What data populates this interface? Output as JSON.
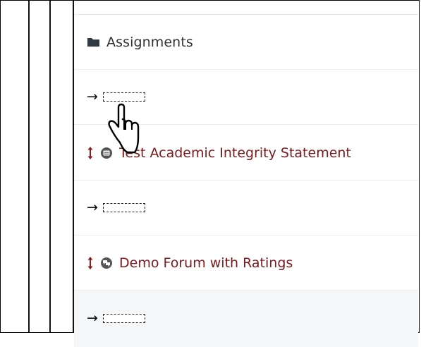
{
  "section": {
    "title": "Assignments",
    "icon": "folder-icon"
  },
  "rows": [
    {
      "type": "dropzone",
      "arrow": "→"
    },
    {
      "type": "activity",
      "label": "Test Academic Integrity Statement",
      "icon": "quiz-icon",
      "move_icon": "move-icon"
    },
    {
      "type": "dropzone",
      "arrow": "→"
    },
    {
      "type": "activity",
      "label": "Demo Forum with Ratings",
      "icon": "forum-icon",
      "move_icon": "move-icon"
    },
    {
      "type": "dropzone",
      "arrow": "→"
    }
  ],
  "colors": {
    "link": "#7a1a1a",
    "move": "#8b1a1a",
    "text": "#333333"
  },
  "cursor": "hand-pointer-icon"
}
